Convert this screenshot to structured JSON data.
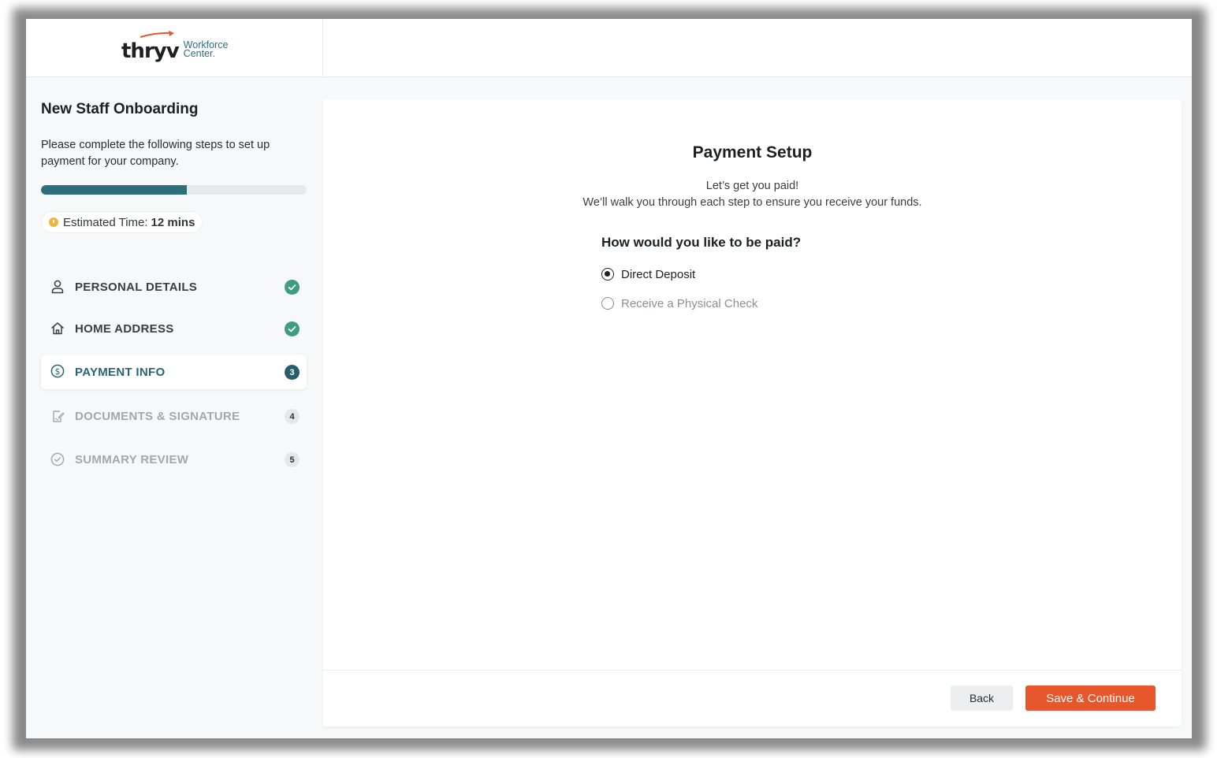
{
  "brand": {
    "wordmark": "thryv",
    "sub_line1": "Workforce",
    "sub_line2": "Center.",
    "accent_color": "#e8572b",
    "teal_color": "#2f6f7b"
  },
  "sidebar": {
    "title": "New Staff Onboarding",
    "description": "Please complete the following steps to set up payment for your company.",
    "progress_fraction": 0.55,
    "estimated_time_label": "Estimated Time:",
    "estimated_time_value": "12 mins",
    "steps": [
      {
        "label": "PERSONAL DETAILS",
        "icon": "person-icon",
        "status": "complete",
        "badge": ""
      },
      {
        "label": "HOME ADDRESS",
        "icon": "home-icon",
        "status": "complete",
        "badge": ""
      },
      {
        "label": "PAYMENT INFO",
        "icon": "dollar-circle-icon",
        "status": "current",
        "badge": "3"
      },
      {
        "label": "DOCUMENTS & SIGNATURE",
        "icon": "document-sign-icon",
        "status": "todo",
        "badge": "4"
      },
      {
        "label": "SUMMARY REVIEW",
        "icon": "check-circle-icon",
        "status": "todo",
        "badge": "5"
      }
    ]
  },
  "main": {
    "title": "Payment Setup",
    "subtitle_line1": "Let’s get you paid!",
    "subtitle_line2": "We’ll walk you through each step to ensure you receive your funds.",
    "question": "How would you like to be paid?",
    "options": [
      {
        "label": "Direct Deposit",
        "selected": true
      },
      {
        "label": "Receive a Physical Check",
        "selected": false
      }
    ],
    "back_label": "Back",
    "save_label": "Save & Continue"
  }
}
